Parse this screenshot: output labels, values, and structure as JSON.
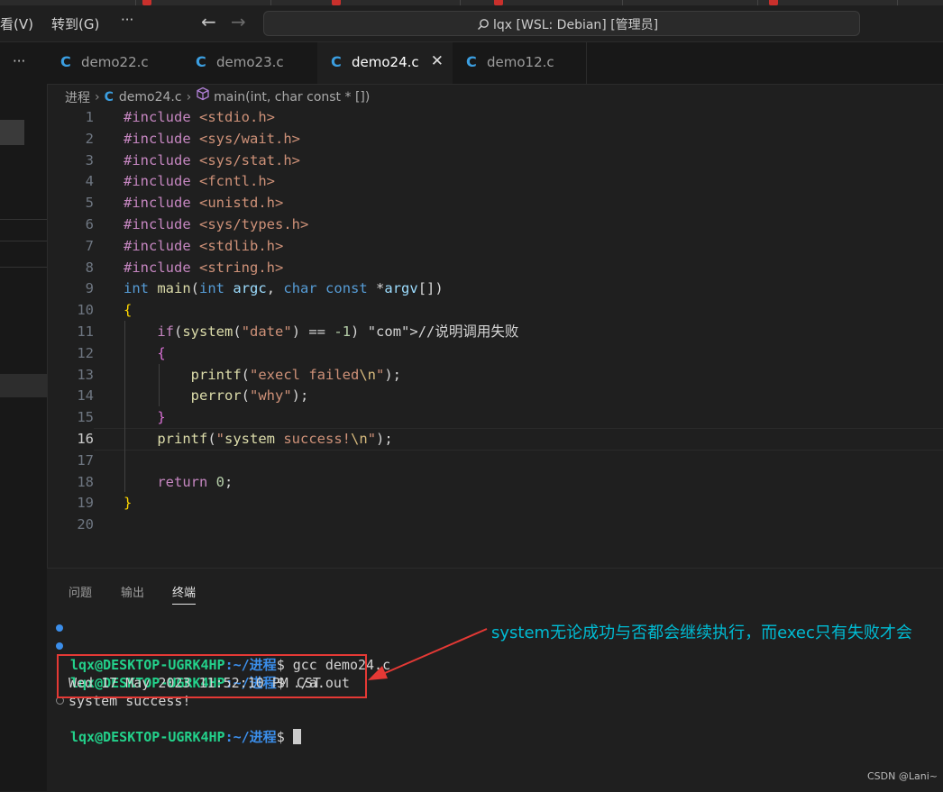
{
  "menu": {
    "view": "看(V)",
    "goto": "转到(G)",
    "more": "···"
  },
  "nav": {
    "back": "←",
    "forward": "→"
  },
  "command_center": {
    "text": "lqx [WSL: Debian] [管理员]",
    "icon": "search-icon"
  },
  "sidebar": {
    "more": "···"
  },
  "tabs": [
    {
      "label": "demo22.c",
      "active": false
    },
    {
      "label": "demo23.c",
      "active": false
    },
    {
      "label": "demo24.c",
      "active": true,
      "close": "✕"
    },
    {
      "label": "demo12.c",
      "active": false
    }
  ],
  "breadcrumb": {
    "folder": "进程",
    "file": "demo24.c",
    "symbol": "main(int, char const * [])"
  },
  "code": {
    "lines": [
      "#include <stdio.h>",
      "#include <sys/wait.h>",
      "#include <sys/stat.h>",
      "#include <fcntl.h>",
      "#include <unistd.h>",
      "#include <sys/types.h>",
      "#include <stdlib.h>",
      "#include <string.h>",
      "int main(int argc, char const *argv[])",
      "{",
      "    if(system(\"date\") == -1) //说明调用失败",
      "    {",
      "        printf(\"execl failed\\n\");",
      "        perror(\"why\");",
      "    }",
      "    printf(\"system success!\\n\");",
      "",
      "    return 0;",
      "}",
      ""
    ],
    "current_line": 16
  },
  "panel": {
    "tabs": [
      "问题",
      "输出",
      "终端"
    ],
    "active_tab": "终端"
  },
  "terminal": {
    "user": "lqx@DESKTOP-UGRK4HP",
    "path": ":~/进程",
    "prompt": "$",
    "cmd1": " gcc demo24.c",
    "cmd2": " ./a.out",
    "out1": "Wed 17 May 2023 11:52:10 PM CST",
    "out2": "system success!"
  },
  "annotation": {
    "text": "system无论成功与否都会继续执行，而exec只有失败才会"
  },
  "watermark": "CSDN @Lani~",
  "colors": {
    "accent_blue": "#3b8eea",
    "terminal_green": "#23d18b",
    "annotation": "#00bcd4",
    "highlight_box": "#e53935"
  }
}
